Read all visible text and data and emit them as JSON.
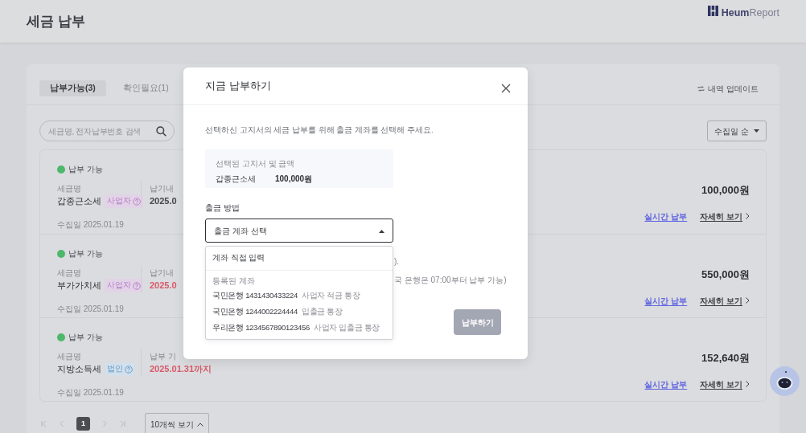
{
  "header": {
    "title": "세금 납부",
    "logo": {
      "bold": "Heum",
      "light": "Report"
    }
  },
  "tabs": [
    {
      "label": "납부가능(3)",
      "selected": true
    },
    {
      "label": "확인필요(1)",
      "selected": false
    }
  ],
  "update_link": "내역 업데이트",
  "search": {
    "placeholder": "세금명, 전자납부번호 검색"
  },
  "sort": {
    "value": "수집일 순"
  },
  "items": [
    {
      "status": "납부 가능",
      "color": "#4cb86a",
      "name_label": "세금명",
      "name": "갑종근소세",
      "tag": {
        "label": "사업자",
        "kind": "business"
      },
      "due_label": "납기내",
      "due": "2025.0",
      "due_urgent": false,
      "collected": "수집일 2025.01.19",
      "amount": "100,000원",
      "pay_link": "실시간 납부",
      "detail_link": "자세히 보기"
    },
    {
      "status": "납부 가능",
      "color": "#4cb86a",
      "name_label": "세금명",
      "name": "부가가치세",
      "tag": {
        "label": "사업자",
        "kind": "business"
      },
      "due_label": "납기내",
      "due": "2025.0",
      "due_urgent": true,
      "collected": "수집일 2025.01.19",
      "amount": "550,000원",
      "pay_link": "실시간 납부",
      "detail_link": "자세히 보기"
    },
    {
      "status": "납부 가능",
      "color": "#4cb86a",
      "name_label": "세금명",
      "name": "지방소득세",
      "tag": {
        "label": "법인",
        "kind": "corporate"
      },
      "due_label": "납부 기",
      "due": "2025.01.31까지",
      "due_urgent": true,
      "collected": "수집일 2025.01.19",
      "amount": "152,640원",
      "pay_link": "실시간 납부",
      "detail_link": "자세히 보기"
    }
  ],
  "pagination": {
    "pages": [
      {
        "label": "1",
        "selected": true
      }
    ],
    "page_size": "10개씩 보기"
  },
  "modal": {
    "title": "지금 납부하기",
    "description": "선택하신 고지서의 세금 납부를 위해 출금 계좌를 선택해 주세요.",
    "summary": {
      "label": "선택된 고지서 및 금액",
      "name": "갑종근소세",
      "amount": "100,000원"
    },
    "method_label": "출금 방법",
    "select": {
      "placeholder": "출금 계좌 선택",
      "expanded": true
    },
    "menu": {
      "direct": "계좌 직접 입력",
      "group_label": "등록된 계좌",
      "accounts": [
        {
          "account": "국민은행 1431430433224",
          "memo": "사업자 적금 통장"
        },
        {
          "account": "국민은행 1244002224444",
          "memo": "입출금 통장"
        },
        {
          "account": "우리은행 1234567890123456",
          "memo": "사업자 입출금 통장"
        }
      ]
    },
    "note_fragments": [
      ").",
      "국 은행은 07:00부터 납부 가능)"
    ],
    "submit": {
      "label": "납부하기",
      "disabled": true
    }
  }
}
